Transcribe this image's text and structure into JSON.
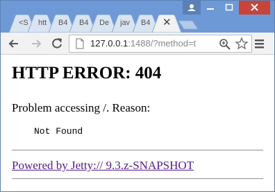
{
  "browser": {
    "tabs": [
      {
        "label": "<S"
      },
      {
        "label": "htt"
      },
      {
        "label": "B4"
      },
      {
        "label": "B4"
      },
      {
        "label": "De"
      },
      {
        "label": "jav"
      },
      {
        "label": "B4"
      },
      {
        "label": ""
      }
    ],
    "active_tab_close": "✕",
    "address": {
      "host": "127.0.0.1",
      "rest": ":1488/?method=t"
    },
    "colors": {
      "frame": "#6d99d6",
      "toolbar": "#f2f2f2",
      "close_button": "#c7443b"
    }
  },
  "page": {
    "heading": "HTTP ERROR: 404",
    "reason": "Problem accessing /. Reason:",
    "message": "Not Found",
    "footer_link": "Powered by Jetty:// 9.3.z-SNAPSHOT"
  }
}
